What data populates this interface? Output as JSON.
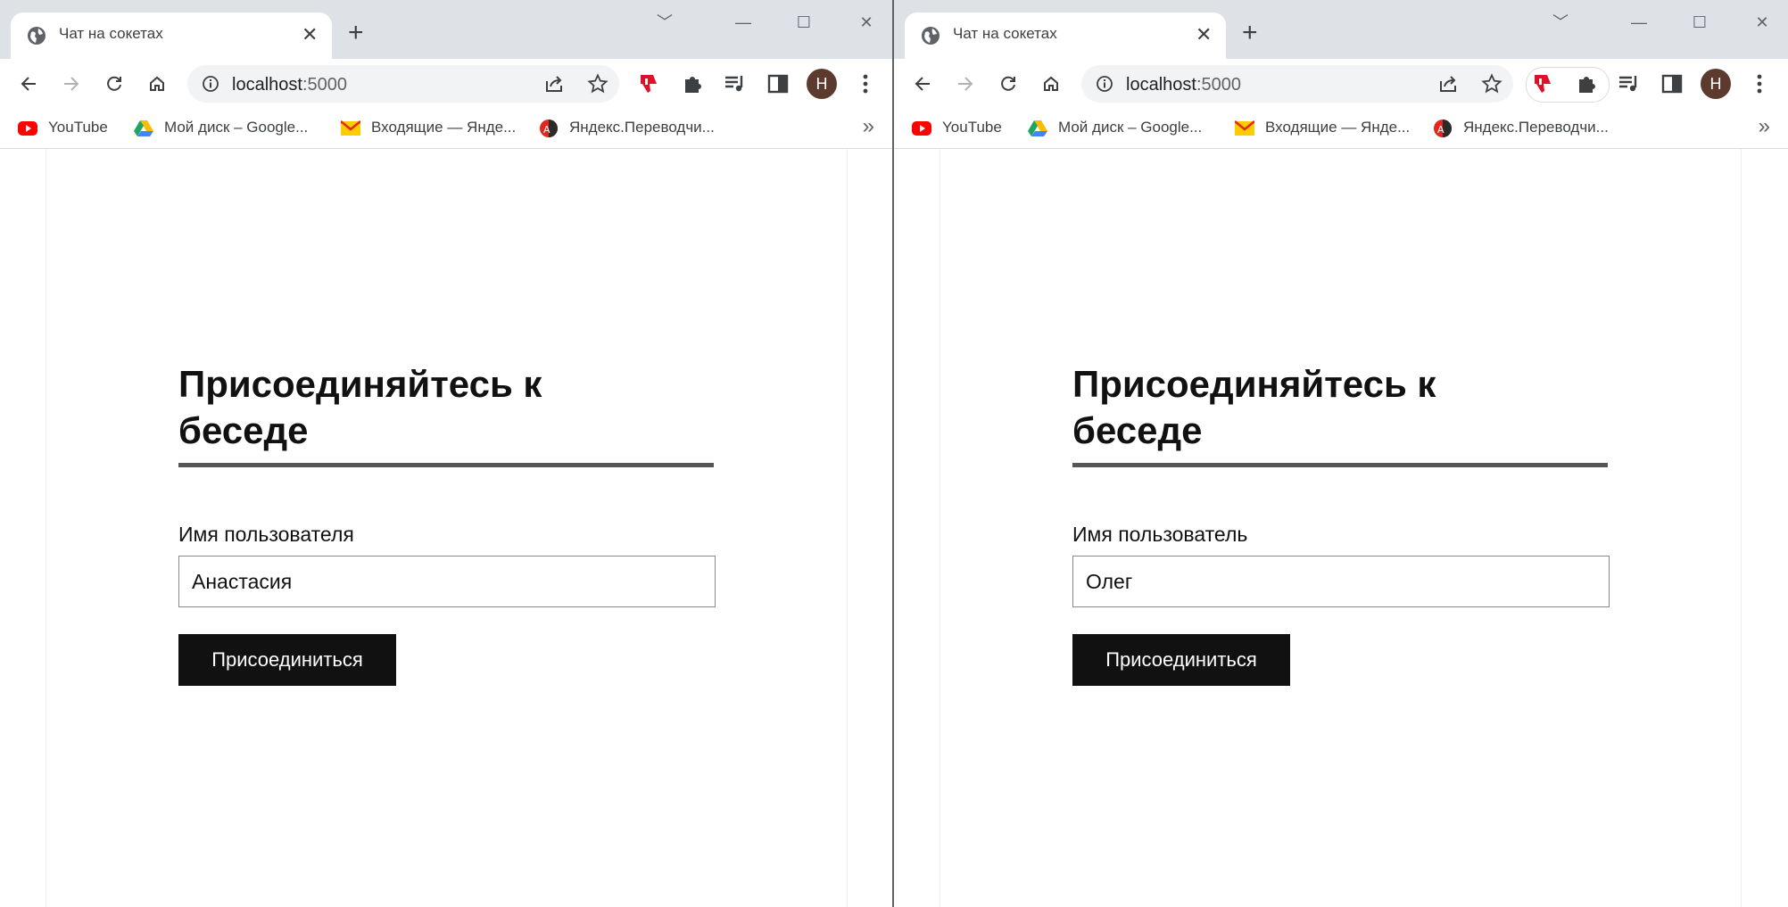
{
  "windows": [
    {
      "tab_title": "Чат на сокетах",
      "url_host": "localhost",
      "url_port": ":5000",
      "avatar_initial": "H",
      "bookmarks": [
        "YouTube",
        "Мой диск – Google...",
        "Входящие — Янде...",
        "Яндекс.Переводчи..."
      ],
      "form": {
        "title": "Присоединяйтесь к беседе",
        "username_label": "Имя пользователя",
        "username_value": "Анастасия",
        "join_button": "Присоединиться"
      }
    },
    {
      "tab_title": "Чат на сокетах",
      "url_host": "localhost",
      "url_port": ":5000",
      "avatar_initial": "H",
      "bookmarks": [
        "YouTube",
        "Мой диск – Google...",
        "Входящие — Янде...",
        "Яндекс.Переводчи..."
      ],
      "form": {
        "title": "Присоединяйтесь к беседе",
        "username_label": "Имя пользователь",
        "username_value": "Олег",
        "join_button": "Присоединиться"
      }
    }
  ],
  "colors": {
    "tabbar": "#dee1e6",
    "omnibox": "#f1f3f4",
    "button": "#111111",
    "rule": "#555555",
    "avatar": "#5d3a2e"
  },
  "icons": [
    "globe-icon",
    "close-icon",
    "plus-icon",
    "back-arrow-icon",
    "forward-arrow-icon",
    "reload-icon",
    "home-icon",
    "info-icon",
    "share-icon",
    "star-icon",
    "extension-thumb-down-icon",
    "puzzle-icon",
    "media-queue-icon",
    "side-panel-icon",
    "kebab-menu-icon",
    "youtube-icon",
    "google-drive-icon",
    "yandex-mail-icon",
    "yandex-translate-icon"
  ]
}
